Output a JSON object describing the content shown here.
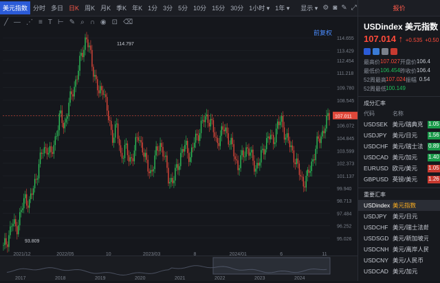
{
  "top_tabs": [
    "美元指数",
    "分时",
    "多日",
    "日K",
    "周K",
    "月K",
    "季K",
    "年K",
    "1分",
    "3分",
    "5分",
    "10分",
    "15分",
    "30分",
    "1小时",
    "1年"
  ],
  "active_tab": "日K",
  "display_label": "显示",
  "restore_label": "前复权",
  "right_panel": {
    "title": "报价",
    "symbol": "USDindex",
    "name": "美元指数",
    "price": "107.014",
    "change": "+0.535",
    "change_pct": "+0.50",
    "stats": [
      {
        "k": "最高价",
        "v": "107.027",
        "k2": "开盘价",
        "v2": "106.4"
      },
      {
        "k": "最低价",
        "v": "106.454",
        "k2": "昨收价",
        "v2": "106.4"
      },
      {
        "k": "52周最高",
        "v": "107.024",
        "k2": "振幅",
        "v2": "0.54"
      },
      {
        "k": "52周最低",
        "v": "100.149",
        "k2": "",
        "v2": ""
      }
    ],
    "section1_title": "成分汇率",
    "col_code": "代码",
    "col_name": "名称",
    "components": [
      {
        "code": "USDSEK",
        "name": "美元/瑞典克",
        "pct": "1.05",
        "color": "#1a9a4a"
      },
      {
        "code": "USDJPY",
        "name": "美元/日元",
        "pct": "1.56",
        "color": "#1a9a4a"
      },
      {
        "code": "USDCHF",
        "name": "美元/瑞士法",
        "pct": "0.89",
        "color": "#1a9a4a"
      },
      {
        "code": "USDCAD",
        "name": "美元/加元",
        "pct": "1.40",
        "color": "#1a9a4a"
      },
      {
        "code": "EURUSD",
        "name": "欧元/美元",
        "pct": "1.05",
        "color": "#c83a30"
      },
      {
        "code": "GBPUSD",
        "name": "英镑/美元",
        "pct": "1.26",
        "color": "#c83a30"
      }
    ],
    "section2_title": "重要汇率",
    "important": [
      {
        "code": "USDindex",
        "name": "美元指数",
        "selected": true
      },
      {
        "code": "USDJPY",
        "name": "美元/日元"
      },
      {
        "code": "USDCHF",
        "name": "美元/瑞士法郎"
      },
      {
        "code": "USDSGD",
        "name": "美元/新加坡元"
      },
      {
        "code": "USDCNH",
        "name": "美元/离岸人民币"
      },
      {
        "code": "USDCNY",
        "name": "美元/人民币"
      },
      {
        "code": "USDCAD",
        "name": "美元/加元"
      }
    ]
  },
  "chart_data": {
    "type": "candlestick",
    "y_ticks": [
      "114.655",
      "113.429",
      "112.454",
      "111.218",
      "109.780",
      "108.545",
      "107.011",
      "106.072",
      "104.845",
      "103.599",
      "102.373",
      "101.137",
      "99.940",
      "98.713",
      "97.484",
      "96.252",
      "95.026"
    ],
    "current_price_label": "107.011",
    "high_label": "114.797",
    "low_label": "93.809",
    "x_labels": [
      "2021/12",
      "2022/05",
      "10",
      "2023/03",
      "8",
      "2024/01",
      "6",
      "11"
    ],
    "nav_years": [
      "2017",
      "2018",
      "2019",
      "2020",
      "2021",
      "2022",
      "2023",
      "2024"
    ],
    "ylim": [
      93.8,
      115.0
    ],
    "series": [
      94,
      95,
      96.5,
      96,
      97.5,
      99,
      98.5,
      100,
      102,
      103.5,
      104,
      103,
      105,
      107,
      106,
      108,
      109.5,
      111,
      113,
      114.8,
      113,
      111,
      109,
      110,
      107,
      105,
      106,
      103,
      104,
      102.5,
      103.5,
      105,
      104,
      102,
      101.5,
      103,
      104.5,
      103,
      101,
      100.5,
      102,
      103.5,
      104,
      103,
      104.5,
      105.5,
      106.5,
      107,
      106,
      104.5,
      105,
      106,
      104.5,
      103.5,
      102,
      103,
      104,
      103,
      102,
      102.5,
      104,
      105,
      104.5,
      106,
      106.5,
      105,
      104,
      103,
      101.5,
      100.5,
      101,
      102.5,
      104,
      105,
      106,
      107
    ]
  }
}
